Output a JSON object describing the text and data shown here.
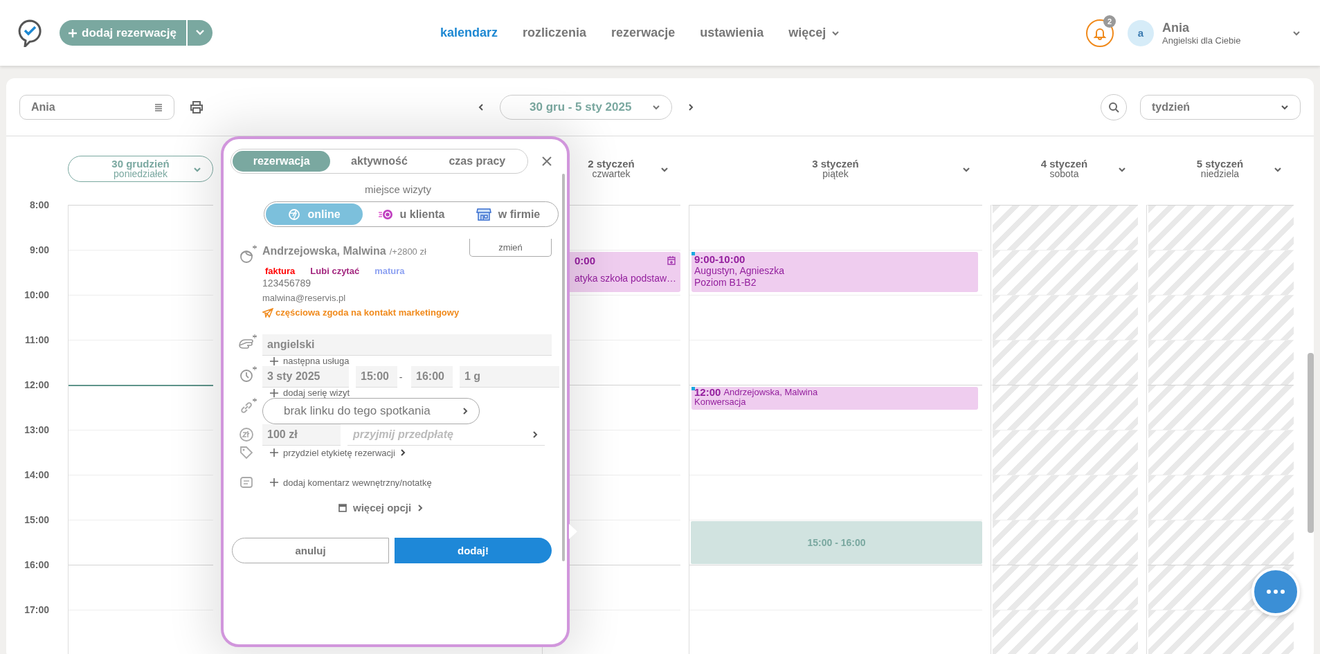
{
  "header": {
    "add_button": "dodaj rezerwację",
    "nav": [
      {
        "label": "kalendarz",
        "selected": true,
        "kind": "link"
      },
      {
        "label": "rozliczenia",
        "selected": false,
        "kind": "link"
      },
      {
        "label": "rezerwacje",
        "selected": false,
        "kind": "link"
      },
      {
        "label": "ustawienia",
        "selected": false,
        "kind": "link"
      },
      {
        "label": "więcej",
        "selected": false,
        "kind": "menu"
      }
    ],
    "notifications": "2",
    "user": {
      "initial": "a",
      "name": "Ania",
      "subtitle": "Angielski dla Ciebie"
    }
  },
  "toolbar": {
    "staff": "Ania",
    "range": "30 gru - 5 sty 2025",
    "view": "tydzień"
  },
  "times": [
    "8:00",
    "9:00",
    "10:00",
    "11:00",
    "12:00",
    "13:00",
    "14:00",
    "15:00",
    "16:00",
    "17:00"
  ],
  "days": [
    {
      "date": "30 grudzień",
      "weekday": "poniedziałek",
      "selected": true,
      "cells": [
        {
          "kind": "free"
        },
        {
          "kind": "free"
        },
        {
          "kind": "free"
        },
        {
          "kind": "free"
        },
        {
          "kind": "now"
        },
        {
          "kind": "free"
        },
        {
          "kind": "free"
        },
        {
          "kind": "free"
        },
        {
          "kind": "free"
        },
        {
          "kind": "free"
        }
      ]
    },
    {
      "date": "2 styczeń",
      "weekday": "czwartek",
      "selected": false,
      "cells": [
        {
          "kind": "free"
        },
        {
          "kind": "booking",
          "time": "0:00",
          "lines": [
            "atyka szkoła podstaw…"
          ],
          "icon": true
        },
        {
          "kind": "free"
        },
        {
          "kind": "free"
        },
        {
          "kind": "free"
        },
        {
          "kind": "free"
        },
        {
          "kind": "free"
        },
        {
          "kind": "free"
        },
        {
          "kind": "free"
        },
        {
          "kind": "free"
        }
      ]
    },
    {
      "date": "3 styczeń",
      "weekday": "piątek",
      "selected": false,
      "cells": [
        {
          "kind": "free"
        },
        {
          "kind": "booking",
          "time": "9:00-10:00",
          "lines": [
            "Augustyn, Agnieszka",
            "Poziom B1-B2"
          ],
          "icon": false
        },
        {
          "kind": "free"
        },
        {
          "kind": "free"
        },
        {
          "kind": "brief",
          "time": "12:00",
          "name": "Andrzejowska, Malwina",
          "lines": [
            "Konwersacja"
          ]
        },
        {
          "kind": "free"
        },
        {
          "kind": "free"
        },
        {
          "kind": "selection",
          "label": "15:00 - 16:00"
        },
        {
          "kind": "free"
        },
        {
          "kind": "free"
        }
      ]
    },
    {
      "date": "4 styczeń",
      "weekday": "sobota",
      "selected": false,
      "cells": [
        {
          "kind": "closed"
        },
        {
          "kind": "closed"
        },
        {
          "kind": "closed"
        },
        {
          "kind": "closed"
        },
        {
          "kind": "closed"
        },
        {
          "kind": "closed"
        },
        {
          "kind": "closed"
        },
        {
          "kind": "closed"
        },
        {
          "kind": "closed"
        },
        {
          "kind": "closed"
        }
      ]
    },
    {
      "date": "5 styczeń",
      "weekday": "niedziela",
      "selected": false,
      "cells": [
        {
          "kind": "closed"
        },
        {
          "kind": "closed"
        },
        {
          "kind": "closed"
        },
        {
          "kind": "closed"
        },
        {
          "kind": "closed"
        },
        {
          "kind": "closed"
        },
        {
          "kind": "closed"
        },
        {
          "kind": "closed"
        },
        {
          "kind": "closed"
        },
        {
          "kind": "closed"
        }
      ]
    }
  ],
  "booking_popup": {
    "tabs": [
      {
        "label": "rezerwacja",
        "selected": true
      },
      {
        "label": "aktywność",
        "selected": false
      },
      {
        "label": "czas pracy",
        "selected": false
      }
    ],
    "place_label": "miejsce wizyty",
    "places": [
      {
        "label": "online",
        "selected": true,
        "kind": "online"
      },
      {
        "label": "u klienta",
        "selected": false,
        "kind": "client"
      },
      {
        "label": "w firmie",
        "selected": false,
        "kind": "office"
      }
    ],
    "client": {
      "name": "Andrzejowska, Malwina",
      "balance": "/+2800 zł",
      "change": "zmień",
      "required": true,
      "tags": [
        {
          "label": "faktura",
          "color": "#ff0000"
        },
        {
          "label": "Lubi czytać",
          "color": "#a3277f"
        },
        {
          "label": "matura",
          "color": "#8ea2f2"
        }
      ],
      "phone": "123456789",
      "email": "malwina@reservis.pl",
      "consent": "częściowa zgoda na kontakt marketingowy"
    },
    "service": {
      "value": "angielski",
      "add": "następna usługa",
      "required": true
    },
    "time": {
      "date": "3 sty 2025",
      "start": "15:00",
      "separator": "-",
      "end": "16:00",
      "duration": "1 g",
      "add": "dodaj serię wizyt",
      "required": true
    },
    "link": {
      "label": "brak linku do tego spotkania",
      "required": true
    },
    "payment": {
      "price": "100 zł",
      "placeholder": "przyjmij przedpłatę"
    },
    "label_action": "przydziel etykietę rezerwacji",
    "comment_action": "dodaj komentarz wewnętrzny/notatkę",
    "more": "więcej opcji",
    "cancel": "anuluj",
    "submit": "dodaj!"
  }
}
